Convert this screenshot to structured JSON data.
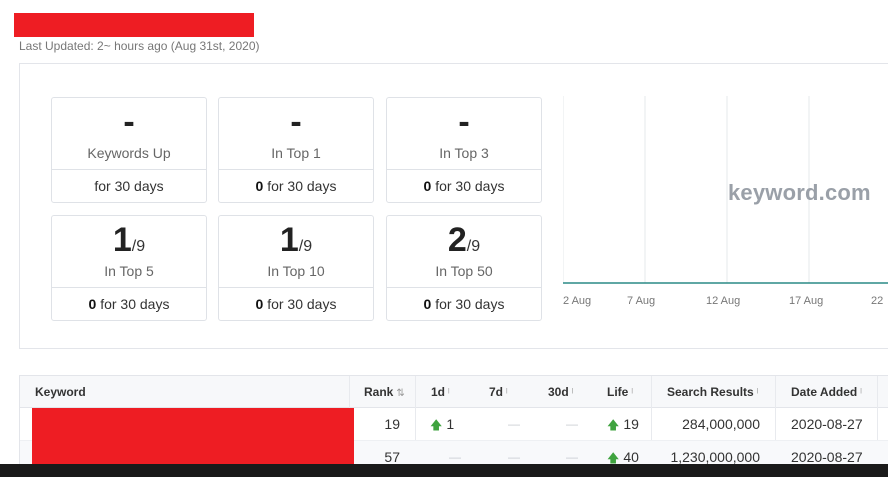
{
  "header": {
    "last_updated": "Last Updated: 2~ hours ago (Aug 31st, 2020)"
  },
  "stats": [
    {
      "value": "-",
      "total": "",
      "label": "Keywords Up",
      "footer_bold": "",
      "footer_text": "for 30 days"
    },
    {
      "value": "-",
      "total": "",
      "label": "In Top 1",
      "footer_bold": "0",
      "footer_text": " for 30 days"
    },
    {
      "value": "-",
      "total": "",
      "label": "In Top 3",
      "footer_bold": "0",
      "footer_text": " for 30 days"
    },
    {
      "value": "1",
      "total": "/9",
      "label": "In Top 5",
      "footer_bold": "0",
      "footer_text": " for 30 days"
    },
    {
      "value": "1",
      "total": "/9",
      "label": "In Top 10",
      "footer_bold": "0",
      "footer_text": " for 30 days"
    },
    {
      "value": "2",
      "total": "/9",
      "label": "In Top 50",
      "footer_bold": "0",
      "footer_text": " for 30 days"
    }
  ],
  "chart": {
    "watermark": "keyword.com",
    "x_labels": [
      "2 Aug",
      "7 Aug",
      "12 Aug",
      "17 Aug",
      "22"
    ],
    "line_color": "#2a8a86",
    "grid_color": "#e6e8eb"
  },
  "table": {
    "columns": {
      "keyword": "Keyword",
      "rank": "Rank",
      "d1": "1d",
      "d7": "7d",
      "d30": "30d",
      "life": "Life",
      "search_results": "Search Results",
      "date_added": "Date Added"
    },
    "rows": [
      {
        "rank": "19",
        "d1": "1",
        "d1_dir": "up",
        "d7": "—",
        "d30": "—",
        "life": "19",
        "life_dir": "up",
        "search_results": "284,000,000",
        "date_added": "2020-08-27"
      },
      {
        "rank": "57",
        "d1": "—",
        "d1_dir": "",
        "d7": "—",
        "d30": "—",
        "life": "40",
        "life_dir": "up",
        "search_results": "1,230,000,000",
        "date_added": "2020-08-27"
      }
    ]
  },
  "colors": {
    "redaction": "#ee1d23",
    "up_arrow": "#3fa33f"
  },
  "icons": {
    "up_arrow": "arrow-up-icon",
    "sort": "sort-icon"
  }
}
